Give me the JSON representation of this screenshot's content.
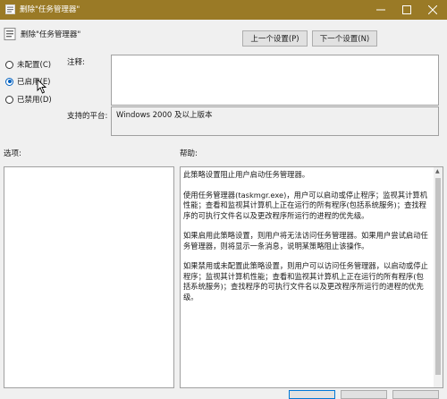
{
  "window": {
    "title": "删除\"任务管理器\"",
    "title_bar_color": "#9a7a26",
    "controls": [
      "minimize-icon",
      "maximize-icon",
      "close-icon"
    ]
  },
  "header": {
    "policy_name": "删除\"任务管理器\"",
    "prev_label": "上一个设置(P)",
    "next_label": "下一个设置(N)"
  },
  "state": {
    "options": [
      {
        "label": "未配置(C)",
        "checked": false
      },
      {
        "label": "已启用(E)",
        "checked": true
      },
      {
        "label": "已禁用(D)",
        "checked": false
      }
    ]
  },
  "comment": {
    "label": "注释:",
    "value": ""
  },
  "platform": {
    "label": "支持的平台:",
    "value": "Windows 2000 及以上版本"
  },
  "options_panel": {
    "label": "选项:"
  },
  "help": {
    "label": "帮助:",
    "paragraphs": [
      "此策略设置阻止用户启动任务管理器。",
      "使用任务管理器(taskmgr.exe)，用户可以启动或停止程序；监视其计算机性能；查看和监视其计算机上正在运行的所有程序(包括系统服务)；查找程序的可执行文件名以及更改程序所运行的进程的优先级。",
      "如果启用此策略设置，则用户将无法访问任务管理器。如果用户尝试启动任务管理器，则将显示一条消息，说明某策略阻止该操作。",
      "如果禁用或未配置此策略设置，则用户可以访问任务管理器，以启动或停止程序；监视其计算机性能；查看和监视其计算机上正在运行的所有程序(包括系统服务)；查找程序的可执行文件名以及更改程序所运行的进程的优先级。"
    ]
  },
  "footer": {
    "ok_label": "",
    "cancel_label": "",
    "apply_label": ""
  },
  "colors": {
    "accent": "#0060c0",
    "panel_border": "#a0a0a0"
  }
}
